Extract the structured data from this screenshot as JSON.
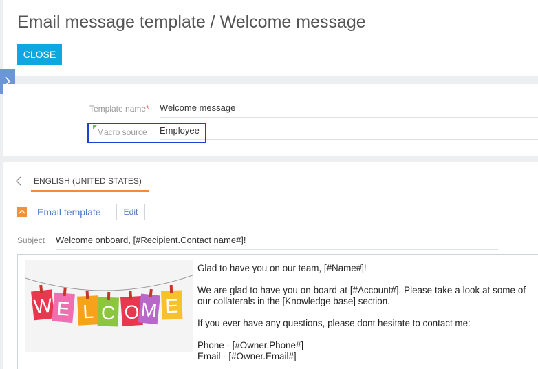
{
  "header": {
    "title": "Email message template / Welcome message",
    "close_label": "CLOSE"
  },
  "fields": {
    "template_name_label": "Template name",
    "required_mark": "*",
    "template_name_value": "Welcome message",
    "macro_source_label": "Macro source",
    "macro_source_value": "Employee"
  },
  "tabs": {
    "language": "ENGLISH (UNITED STATES)"
  },
  "email_section": {
    "title": "Email template",
    "edit_label": "Edit",
    "subject_label": "Subject",
    "subject_value": "Welcome onboard, [#Recipient.Contact name#]!"
  },
  "email_body": {
    "greeting": "Glad to have you on our team, [#Name#]!",
    "paragraph1": "We are glad to have you on board at [#Account#]. Please take a look at some of our collaterals in the [Knowledge base] section.",
    "paragraph2": "If you ever have any questions, please dont hesitate to contact me:",
    "phone": "Phone - [#Owner.Phone#]",
    "email": "Email - [#Owner.Email#]"
  },
  "banner": {
    "letters": [
      "W",
      "E",
      "L",
      "C",
      "O",
      "M",
      "E"
    ],
    "colors": [
      "#e8384f",
      "#f06fb0",
      "#f7a21b",
      "#8cc63f",
      "#e8384f",
      "#b768c9",
      "#f6c12b"
    ]
  }
}
